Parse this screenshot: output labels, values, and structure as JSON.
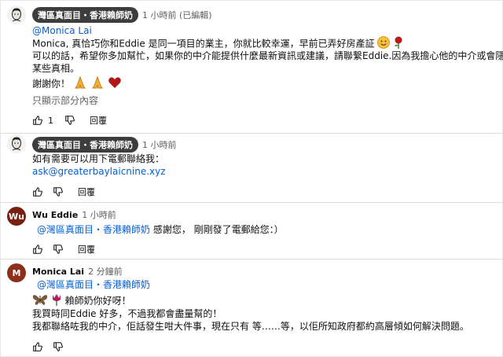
{
  "comments": [
    {
      "author": "灣區真面目・香港賴師奶",
      "time": "1 小時前 (已編輯)",
      "lines": [
        "@Monica Lai",
        "Monica, 真恰巧你和Eddie 是同一項目的業主，你就比較幸運，早前已弄好房產証",
        "可以的話，希望你多加幫忙，如果你的中介能提供什麼最新資訊或建議，請聯繫Eddie.因為我擔心他的中介或會隱瞞",
        "某些真相。",
        "謝謝你！",
        "只顯示部分內容"
      ],
      "likes": "1",
      "reply": "回覆"
    },
    {
      "author": "灣區真面目・香港賴師奶",
      "time": "1 小時前",
      "lines": [
        "如有需要可以用下電郵聯絡我：",
        "ask@greaterbaylaicnine.xyz"
      ],
      "reply": "回覆"
    },
    {
      "author": "Wu Eddie",
      "avatar_letter": "Wu",
      "time": "1 小時前",
      "mention": "@灣區真面目・香港賴師奶",
      "text": " 感謝您， 剛剛發了電郵給您：）",
      "reply": "回覆"
    },
    {
      "author": "Monica Lai",
      "avatar_letter": "M",
      "time": "2 分鐘前",
      "mention": "@灣區真面目・香港賴師奶",
      "lines": [
        "賴師奶你好呀！",
        "我買時同Eddie 好多，不過我都會盡量幫的！",
        "我都聯絡咗我的中介，佢話發生咁大件事，現在只有  等……等，以佢所知政府都約高層傾如何解決問題。"
      ]
    }
  ],
  "colors": {
    "chip": "#3d3d3d",
    "mention": "#065fd4",
    "wu_avatar": "#7a1f12",
    "m_avatar": "#8d2f1a"
  }
}
